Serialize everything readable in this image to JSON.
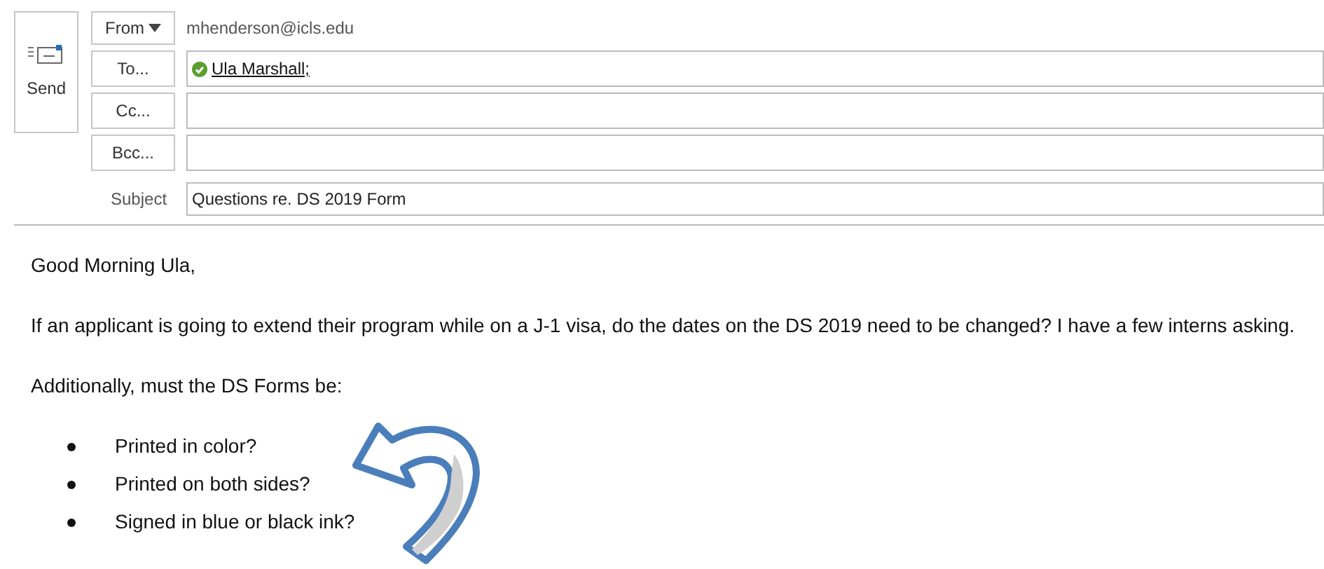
{
  "send_button": {
    "label": "Send"
  },
  "header_fields": [
    {
      "kind": "from",
      "label": "From",
      "value": "mhenderson@icls.edu"
    },
    {
      "kind": "recipients",
      "label": "To...",
      "recipients": [
        {
          "name": "Ula Marshall;",
          "resolved": true
        }
      ]
    },
    {
      "kind": "recipients",
      "label": "Cc..."
    },
    {
      "kind": "recipients",
      "label": "Bcc..."
    },
    {
      "kind": "subject",
      "label": "Subject",
      "value": "Questions re. DS 2019 Form"
    }
  ],
  "body": {
    "paragraphs": [
      "Good Morning Ula,",
      "If an applicant is going to extend their program while on a J-1 visa, do the dates on the DS 2019 need to be changed? I have a few interns asking.",
      "Additionally, must the DS Forms be:"
    ],
    "bullets": [
      "Printed in color?",
      "Printed on both sides?",
      "Signed in blue or black ink?"
    ]
  }
}
